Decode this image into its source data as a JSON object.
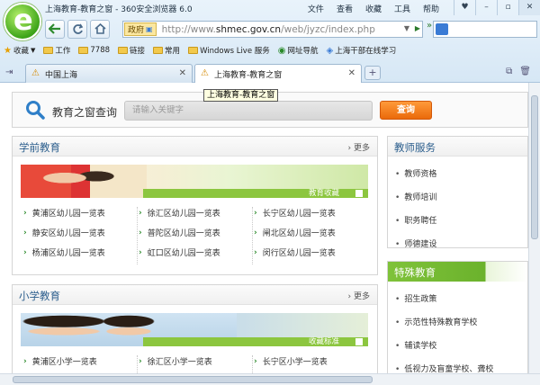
{
  "window": {
    "title": "上海教育-教育之窗 - 360安全浏览器 6.0",
    "menu": [
      "文件",
      "查看",
      "收藏",
      "工具",
      "帮助"
    ]
  },
  "address": {
    "badge": "政府",
    "url_prefix": "http://www.",
    "url_domain": "shmec.gov.cn",
    "url_path": "/web/jyzc/index.php"
  },
  "favorites": {
    "bar_label": "收藏",
    "items": [
      "工作",
      "7788",
      "链接",
      "常用",
      "Windows Live 服务",
      "网址导航",
      "上海干部在线学习"
    ]
  },
  "tabs": [
    {
      "label": "中国上海",
      "active": false
    },
    {
      "label": "上海教育-教育之窗",
      "active": true
    }
  ],
  "tooltip": "上海教育-教育之窗",
  "search": {
    "title": "教育之窗查询",
    "placeholder": "请输入关键字",
    "button": "查询"
  },
  "preschool": {
    "title": "学前教育",
    "more": "更多",
    "banner_label": "教育收藏",
    "items": [
      "黄浦区幼儿园一览表",
      "徐汇区幼儿园一览表",
      "长宁区幼儿园一览表",
      "静安区幼儿园一览表",
      "普陀区幼儿园一览表",
      "闸北区幼儿园一览表",
      "杨浦区幼儿园一览表",
      "虹口区幼儿园一览表",
      "闵行区幼儿园一览表"
    ]
  },
  "primary": {
    "title": "小学教育",
    "more": "更多",
    "banner_label": "收藏标准",
    "items": [
      "黄浦区小学一览表",
      "徐汇区小学一览表",
      "长宁区小学一览表"
    ]
  },
  "teacher": {
    "title": "教师服务",
    "items": [
      "教师资格",
      "教师培训",
      "职务聘任",
      "师德建设"
    ]
  },
  "special": {
    "title": "特殊教育",
    "items": [
      "招生政策",
      "示范性特殊教育学校",
      "辅读学校",
      "低视力及盲童学校、聋校"
    ]
  }
}
